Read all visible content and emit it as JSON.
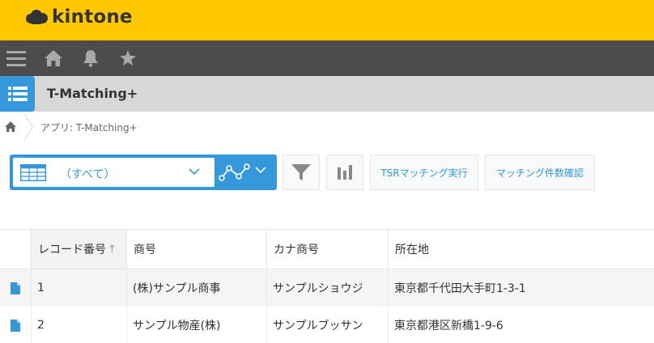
{
  "brand": {
    "logo_text": "kintone"
  },
  "navbar": {
    "icons": [
      "menu-icon",
      "home-icon",
      "bell-icon",
      "star-icon"
    ]
  },
  "app": {
    "title": "T-Matching+"
  },
  "breadcrumb": {
    "text": "アプリ: T-Matching+"
  },
  "toolbar": {
    "view_name": "（すべて）",
    "buttons": {
      "tsr_matching": "TSRマッチング実行",
      "matching_count": "マッチング件数確認"
    }
  },
  "table": {
    "columns": [
      "レコード番号",
      "商号",
      "カナ商号",
      "所在地"
    ],
    "sort_indicator": "↑",
    "rows": [
      {
        "id": "1",
        "name": "(株)サンプル商事",
        "kana": "サンプルショウジ",
        "address": "東京都千代田大手町1-3-1"
      },
      {
        "id": "2",
        "name": "サンプル物産(株)",
        "kana": "サンプルブッサン",
        "address": "東京都港区新橋1-9-6"
      }
    ]
  },
  "colors": {
    "brand_yellow": "#ffc800",
    "nav_dark": "#4c4c4c",
    "accent_blue": "#3498db",
    "header_gray": "#d8d8d8"
  }
}
